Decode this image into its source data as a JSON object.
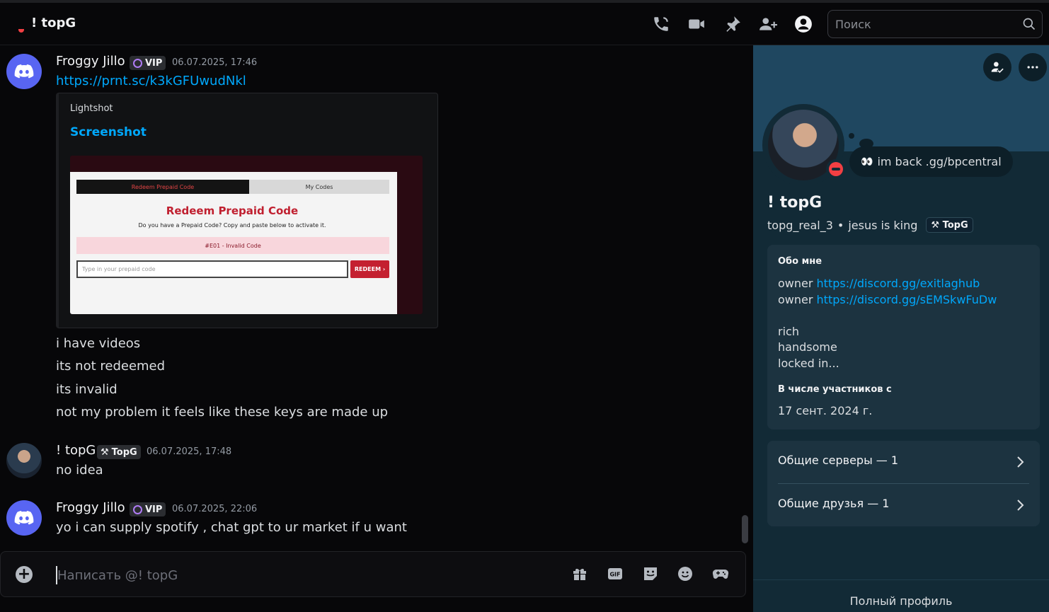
{
  "header": {
    "title": "! topG",
    "search_placeholder": "Поиск"
  },
  "colors": {
    "accent": "#5865f2",
    "link": "#00a8fc",
    "dnd": "#f23f43",
    "panel": "#122a36",
    "banner": "#1f4760"
  },
  "messages": [
    {
      "author": "Froggy Jillo",
      "badge": "VIP",
      "timestamp": "06.07.2025, 17:46",
      "link": "https://prnt.sc/k3kGFUwudNkl",
      "embed": {
        "provider": "Lightshot",
        "title": "Screenshot",
        "screenshot": {
          "tab_active": "Redeem Prepaid Code",
          "tab_inactive": "My Codes",
          "title": "Redeem Prepaid Code",
          "subtitle": "Do you have a Prepaid Code? Copy and paste below to activate it.",
          "error": "#E01 - Invalid Code",
          "input_placeholder": "Type in your prepaid code",
          "button": "REDEEM ›"
        }
      },
      "lines": [
        "i have videos",
        "its not redeemed",
        "its invalid",
        "not my problem it feels like these keys are made up"
      ]
    },
    {
      "author": "! topG",
      "badge": "TopG",
      "timestamp": "06.07.2025, 17:48",
      "lines": [
        "no idea"
      ]
    },
    {
      "author": "Froggy Jillo",
      "badge": "VIP",
      "timestamp": "06.07.2025, 22:06",
      "lines": [
        "yo i can supply spotify , chat gpt to ur market if u want"
      ]
    }
  ],
  "composer": {
    "placeholder": "Написать @! topG"
  },
  "profile": {
    "status": "im back .gg/bpcentral",
    "name": "! topG",
    "username": "topg_real_3",
    "pronouns": "jesus is king",
    "tag": "TopG",
    "about_heading": "Обо мне",
    "about": [
      {
        "prefix": "owner ",
        "link": "https://discord.gg/exitlaghub"
      },
      {
        "prefix": "owner ",
        "link": "https://discord.gg/sEMSkwFuDw"
      }
    ],
    "about_extra": [
      "rich",
      "handsome",
      "locked in..."
    ],
    "member_since_heading": "В числе участников с",
    "member_since": "17 сент. 2024 г.",
    "mutual_servers": "Общие серверы — 1",
    "mutual_friends": "Общие друзья — 1",
    "full_profile": "Полный профиль"
  }
}
